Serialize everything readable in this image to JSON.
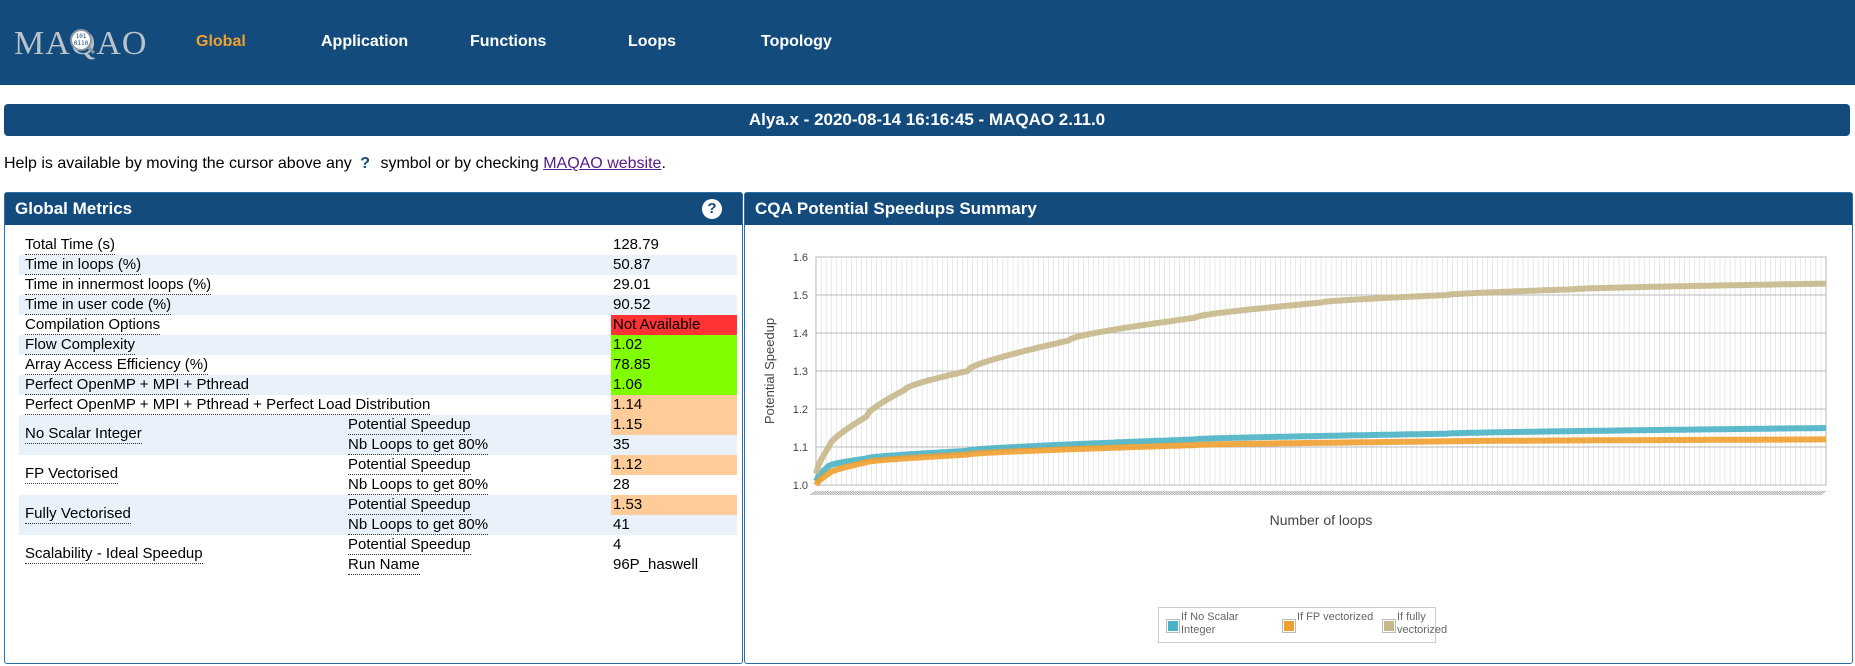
{
  "nav": {
    "logo": "MAQAO",
    "items": [
      {
        "label": "Global"
      },
      {
        "label": "Application"
      },
      {
        "label": "Functions"
      },
      {
        "label": "Loops"
      },
      {
        "label": "Topology"
      }
    ]
  },
  "banner": {
    "title": "Alya.x - 2020-08-14 16:16:45 - MAQAO 2.11.0"
  },
  "help": {
    "before": "Help is available by moving the cursor above any",
    "symbol": "?",
    "middle": "symbol or by checking",
    "link": "MAQAO website",
    "after": "."
  },
  "global_metrics": {
    "title": "Global Metrics",
    "help_icon": "?",
    "rows": [
      {
        "label": "Total Time (s)",
        "value": "128.79"
      },
      {
        "label": "Time in loops (%)",
        "value": "50.87"
      },
      {
        "label": "Time in innermost loops (%)",
        "value": "29.01"
      },
      {
        "label": "Time in user code (%)",
        "value": "90.52"
      },
      {
        "label": "Compilation Options",
        "value": "Not Available",
        "color": "#ff3333"
      },
      {
        "label": "Flow Complexity",
        "value": "1.02",
        "color": "#7fff00"
      },
      {
        "label": "Array Access Efficiency (%)",
        "value": "78.85",
        "color": "#7fff00"
      },
      {
        "label": "Perfect OpenMP + MPI + Pthread",
        "value": "1.06",
        "color": "#7fff00"
      },
      {
        "label": "Perfect OpenMP + MPI + Pthread + Perfect Load Distribution",
        "value": "1.14",
        "color": "#ffcc99"
      }
    ],
    "groups": [
      {
        "label": "No Scalar Integer",
        "sub1": "Potential Speedup",
        "val1": "1.15",
        "color1": "#ffcc99",
        "sub2": "Nb Loops to get 80%",
        "val2": "35"
      },
      {
        "label": "FP Vectorised",
        "sub1": "Potential Speedup",
        "val1": "1.12",
        "color1": "#ffcc99",
        "sub2": "Nb Loops to get 80%",
        "val2": "28"
      },
      {
        "label": "Fully Vectorised",
        "sub1": "Potential Speedup",
        "val1": "1.53",
        "color1": "#ffcc99",
        "sub2": "Nb Loops to get 80%",
        "val2": "41"
      },
      {
        "label": "Scalability - Ideal Speedup",
        "sub1": "Potential Speedup",
        "val1": "4",
        "sub2": "Run Name",
        "val2": "96P_haswell"
      }
    ]
  },
  "cqa": {
    "title": "CQA Potential Speedups Summary"
  },
  "chart_data": {
    "type": "line",
    "ylabel": "Potential Speedup",
    "xlabel": "Number of loops",
    "ylim": [
      1.0,
      1.6
    ],
    "yticks": [
      "1.0",
      "1.1",
      "1.2",
      "1.3",
      "1.4",
      "1.5",
      "1.6"
    ],
    "n_loops": 400,
    "grid": true,
    "legend_position": "bottom",
    "series": [
      {
        "name": "If No Scalar Integer",
        "color": "#4ab3c4",
        "points": [
          [
            0,
            1.01
          ],
          [
            5,
            1.05
          ],
          [
            20,
            1.07
          ],
          [
            60,
            1.09
          ],
          [
            150,
            1.12
          ],
          [
            250,
            1.135
          ],
          [
            400,
            1.15
          ]
        ]
      },
      {
        "name": "If FP vectorized",
        "color": "#f0a030",
        "points": [
          [
            0,
            1.0
          ],
          [
            5,
            1.03
          ],
          [
            20,
            1.06
          ],
          [
            60,
            1.08
          ],
          [
            150,
            1.105
          ],
          [
            250,
            1.115
          ],
          [
            400,
            1.12
          ]
        ]
      },
      {
        "name": "If fully vectorized",
        "color": "#c6b88a",
        "points": [
          [
            0,
            1.03
          ],
          [
            5,
            1.1
          ],
          [
            20,
            1.18
          ],
          [
            35,
            1.25
          ],
          [
            60,
            1.3
          ],
          [
            100,
            1.38
          ],
          [
            150,
            1.44
          ],
          [
            200,
            1.48
          ],
          [
            250,
            1.5
          ],
          [
            300,
            1.515
          ],
          [
            400,
            1.53
          ]
        ]
      }
    ]
  }
}
